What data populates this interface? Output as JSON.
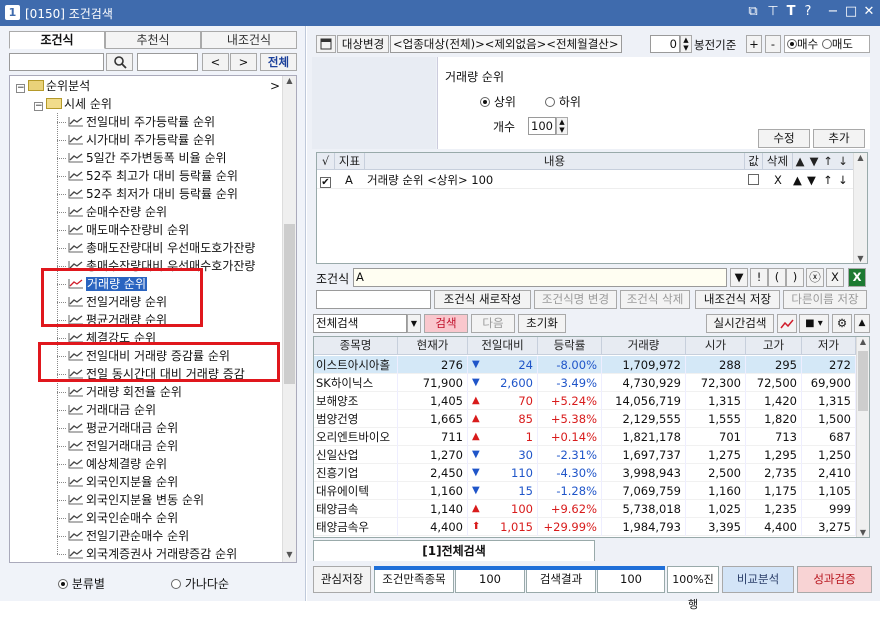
{
  "window": {
    "number": "1",
    "title": "[0150] 조건검색"
  },
  "left": {
    "tabs": [
      "조건식",
      "추천식",
      "내조건식"
    ],
    "search_placeholder": "",
    "nav_prev": "<",
    "nav_next": ">",
    "all_button": "전체",
    "tree": {
      "root": "순위분석",
      "root_arrow": ">",
      "group": "시세 순위",
      "items": [
        "전일대비 주가등락률 순위",
        "시가대비 주가등락률  순위",
        "5일간 주가변동폭 비율 순위",
        "52주 최고가 대비 등락률 순위",
        "52주 최저가 대비 등락률 순위",
        "순매수잔량 순위",
        "매도매수잔량비 순위",
        "총매도잔량대비 우선매도호가잔량",
        "총매수잔량대비 우선매수호가잔량",
        "거래량 순위",
        "전일거래량 순위",
        "평균거래량 순위",
        "체결강도 순위",
        "전일대비 거래량 증감률 순위",
        "전일 동시간대 대비 거래량 증감",
        "거래량 회전율 순위",
        "거래대금 순위",
        "평균거래대금 순위",
        "전일거래대금 순위",
        "예상체결량 순위",
        "외국인지분율 순위",
        "외국인지분율 변동 순위",
        "외국인순매수 순위",
        "전일기관순매수 순위",
        "외국계증권사 거래량증감 순위"
      ]
    },
    "radio_by_category": "분류별",
    "radio_alphabetical": "가나다순"
  },
  "right": {
    "target_change": "대상변경",
    "target_desc": "<업종대상(전체)><제외없음><전체월결산>",
    "period_value": "0",
    "bong_label": "봉전기준",
    "plus": "+",
    "minus": "-",
    "buy_label": "매수",
    "sell_label": "매도",
    "cond_title": "거래량 순위",
    "rank_top": "상위",
    "rank_bottom": "하위",
    "count_label": "개수",
    "count_value": "100",
    "edit_button": "수정",
    "add_button": "추가",
    "cond_table": {
      "headers": [
        "√",
        "지표",
        "내용",
        "값",
        "삭제",
        "▲",
        "▼",
        "↑",
        "↓"
      ],
      "rows": [
        {
          "index": "A",
          "content": "거래량 순위 <상위> 100",
          "delete": "X",
          "up": "▲",
          "down": "▼",
          "top": "↑",
          "bottom": "↓"
        }
      ]
    },
    "formula_label": "조건식",
    "formula_value": "A",
    "formula_buttons": [
      "▼",
      "!",
      "(",
      ")",
      "ⓧ",
      "X",
      "?"
    ],
    "new_formula": "조건식 새로작성",
    "rename_formula": "조건식명 변경",
    "delete_formula": "조건식 삭제",
    "save_my": "내조건식 저장",
    "save_as": "다른이름 저장",
    "search_scope": "전체검색",
    "search_button": "검색",
    "next_button": "다음",
    "reset_button": "초기화",
    "realtime_button": "실시간검색",
    "results": {
      "headers": [
        "종목명",
        "현재가",
        "전일대비",
        "등락률",
        "거래량",
        "시가",
        "고가",
        "저가"
      ],
      "rows": [
        {
          "name": "이스트아시아홀",
          "price": "276",
          "dir": "down",
          "arrow": "▼",
          "change": "24",
          "rate": "-8.00%",
          "volume": "1,709,972",
          "open": "288",
          "high": "295",
          "low": "272"
        },
        {
          "name": "SK하이닉스",
          "price": "71,900",
          "dir": "down",
          "arrow": "▼",
          "change": "2,600",
          "rate": "-3.49%",
          "volume": "4,730,929",
          "open": "72,300",
          "high": "72,500",
          "low": "69,900"
        },
        {
          "name": "보해양조",
          "price": "1,405",
          "dir": "up",
          "arrow": "▲",
          "change": "70",
          "rate": "+5.24%",
          "volume": "14,056,719",
          "open": "1,315",
          "high": "1,420",
          "low": "1,315"
        },
        {
          "name": "범양건영",
          "price": "1,665",
          "dir": "up",
          "arrow": "▲",
          "change": "85",
          "rate": "+5.38%",
          "volume": "2,129,555",
          "open": "1,555",
          "high": "1,820",
          "low": "1,500"
        },
        {
          "name": "오리엔트바이오",
          "price": "711",
          "dir": "up",
          "arrow": "▲",
          "change": "1",
          "rate": "+0.14%",
          "volume": "1,821,178",
          "open": "701",
          "high": "713",
          "low": "687"
        },
        {
          "name": "신일산업",
          "price": "1,270",
          "dir": "down",
          "arrow": "▼",
          "change": "30",
          "rate": "-2.31%",
          "volume": "1,697,737",
          "open": "1,275",
          "high": "1,295",
          "low": "1,250"
        },
        {
          "name": "진흥기업",
          "price": "2,450",
          "dir": "down",
          "arrow": "▼",
          "change": "110",
          "rate": "-4.30%",
          "volume": "3,998,943",
          "open": "2,500",
          "high": "2,735",
          "low": "2,410"
        },
        {
          "name": "대유에이텍",
          "price": "1,160",
          "dir": "down",
          "arrow": "▼",
          "change": "15",
          "rate": "-1.28%",
          "volume": "7,069,759",
          "open": "1,160",
          "high": "1,175",
          "low": "1,105"
        },
        {
          "name": "태양금속",
          "price": "1,140",
          "dir": "up",
          "arrow": "▲",
          "change": "100",
          "rate": "+9.62%",
          "volume": "5,738,018",
          "open": "1,025",
          "high": "1,235",
          "low": "999"
        },
        {
          "name": "태양금속우",
          "price": "4,400",
          "dir": "up",
          "arrow": "⬆",
          "change": "1,015",
          "rate": "+29.99%",
          "volume": "1,984,793",
          "open": "3,395",
          "high": "4,400",
          "low": "3,275"
        }
      ]
    },
    "result_tab": "[1]전체검색",
    "interest_save": "관심저장",
    "condition_match_label": "조건만족종목",
    "condition_match_value": "100",
    "search_result_label": "검색결과",
    "search_result_value": "100",
    "progress_label": "100%진행",
    "progress_fraction": 1.0,
    "compare_button": "비교분석",
    "verify_button": "성과검증"
  }
}
